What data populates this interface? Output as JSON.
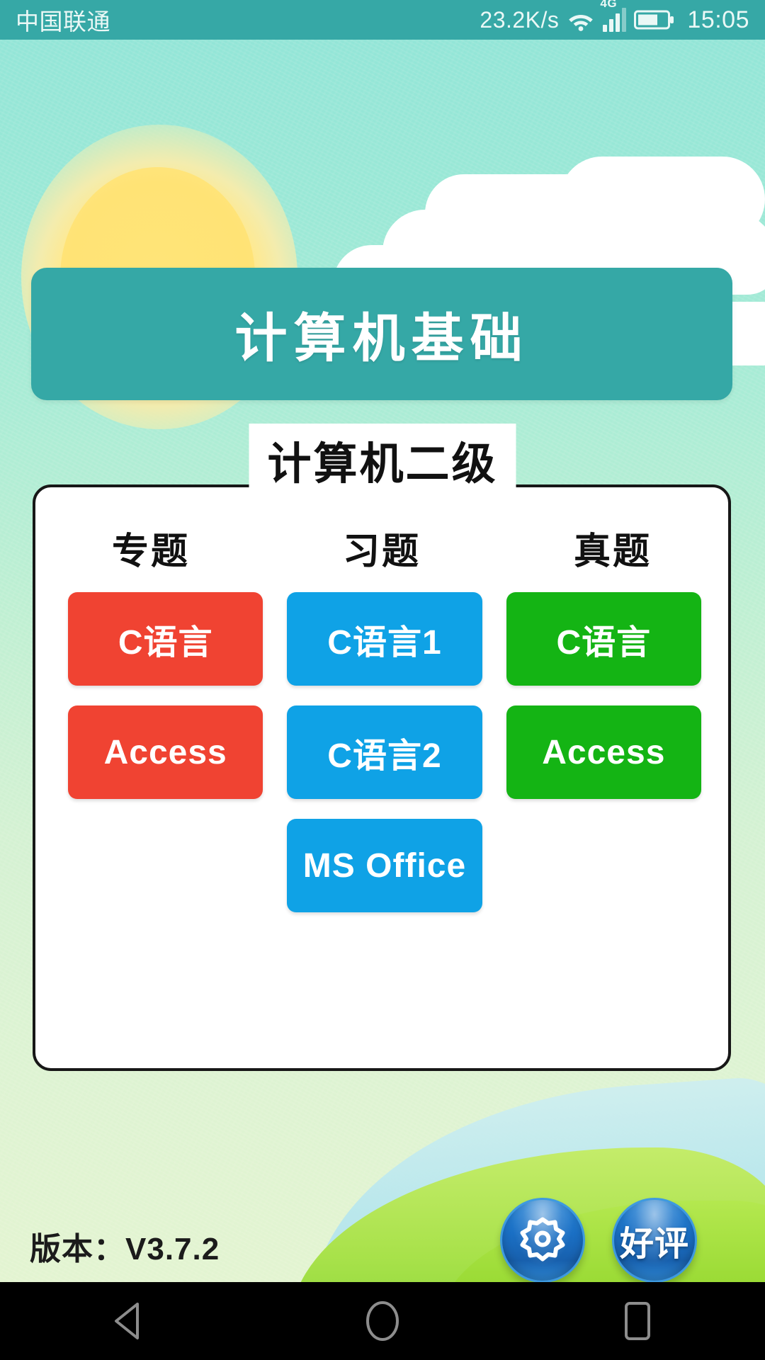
{
  "status_bar": {
    "carrier": "中国联通",
    "network_speed": "23.2K/s",
    "network_type": "4G",
    "wifi_icon": "wifi-icon",
    "signal_icon": "signal-bars-icon",
    "battery_icon": "battery-icon",
    "clock": "15:05",
    "background_color": "#36a8a6",
    "text_color": "#eaf8f6"
  },
  "header": {
    "title": "计算机基础",
    "banner_color": "#35a8a6"
  },
  "card": {
    "legend": "计算机二级",
    "column_headers": [
      "专题",
      "习题",
      "真题"
    ],
    "columns": [
      {
        "header": "专题",
        "color": "#f04332",
        "tiles": [
          {
            "label": "C语言"
          },
          {
            "label": "Access"
          }
        ]
      },
      {
        "header": "习题",
        "color": "#0fa2e6",
        "tiles": [
          {
            "label": "C语言1"
          },
          {
            "label": "C语言2"
          },
          {
            "label": "MS Office"
          }
        ]
      },
      {
        "header": "真题",
        "color": "#14b414",
        "tiles": [
          {
            "label": "C语言"
          },
          {
            "label": "Access"
          }
        ]
      }
    ]
  },
  "footer": {
    "version_label": "版本：V3.7.2",
    "settings_icon": "gear-icon",
    "rate_label": "好评",
    "button_color": "#1a6fc4"
  },
  "nav_bar": {
    "back_icon": "back-triangle-icon",
    "home_icon": "home-circle-icon",
    "recents_icon": "recents-square-icon",
    "background_color": "#000000"
  }
}
